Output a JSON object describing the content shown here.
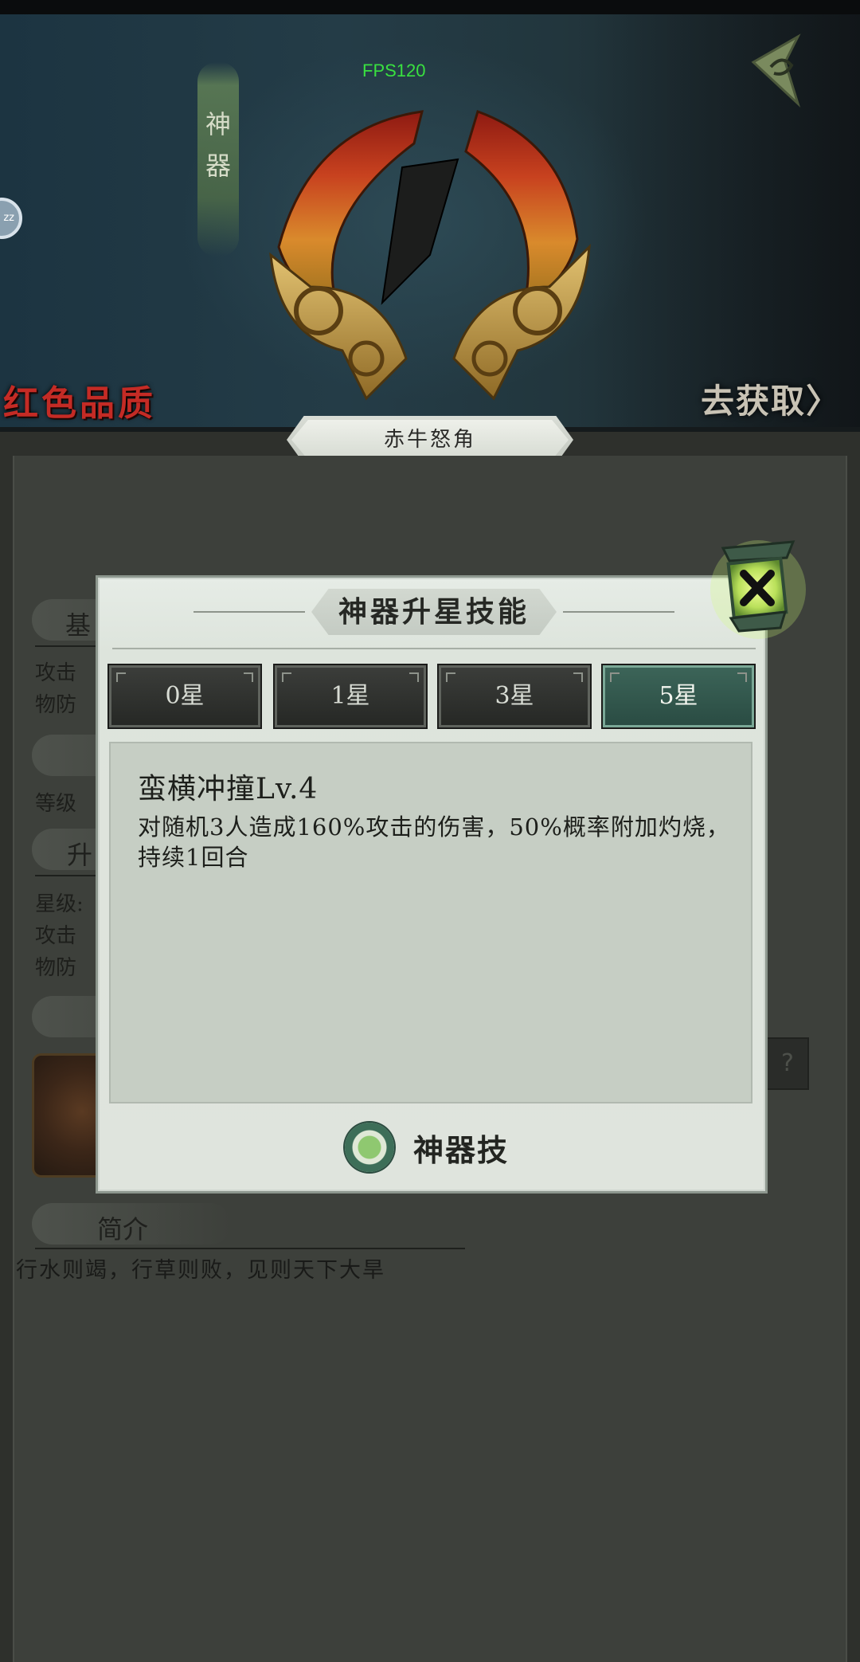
{
  "status": {
    "fps": "FPS120"
  },
  "banner": {
    "category_tag": [
      "神",
      "器"
    ],
    "quality": "红色品质",
    "obtain_link": "去获取〉",
    "artifact_name": "赤牛怒角",
    "side_button": "zz"
  },
  "background_info": {
    "section_basic": "基",
    "attack_label": "攻击",
    "defense_label": "物防",
    "level_label": "等级",
    "section_upgrade": "升",
    "star_label": "星级:",
    "attack_label_2": "攻击",
    "defense_label_2": "物防",
    "help_button": "?",
    "intro_header": "简介",
    "intro_text": "行水则竭，行草则败，见则天下大旱"
  },
  "modal": {
    "title": "神器升星技能",
    "tabs": [
      {
        "label": "0星",
        "active": false
      },
      {
        "label": "1星",
        "active": false
      },
      {
        "label": "3星",
        "active": false
      },
      {
        "label": "5星",
        "active": true
      }
    ],
    "skill_name": "蛮横冲撞Lv.4",
    "skill_description": "对随机3人造成160%攻击的伤害，50%概率附加灼烧，持续1回合",
    "artifact_skill_label": "神器技",
    "colors": {
      "active_tab": "#2f5a4e",
      "fps_text": "#39e040",
      "quality_text": "#c42b25"
    }
  }
}
